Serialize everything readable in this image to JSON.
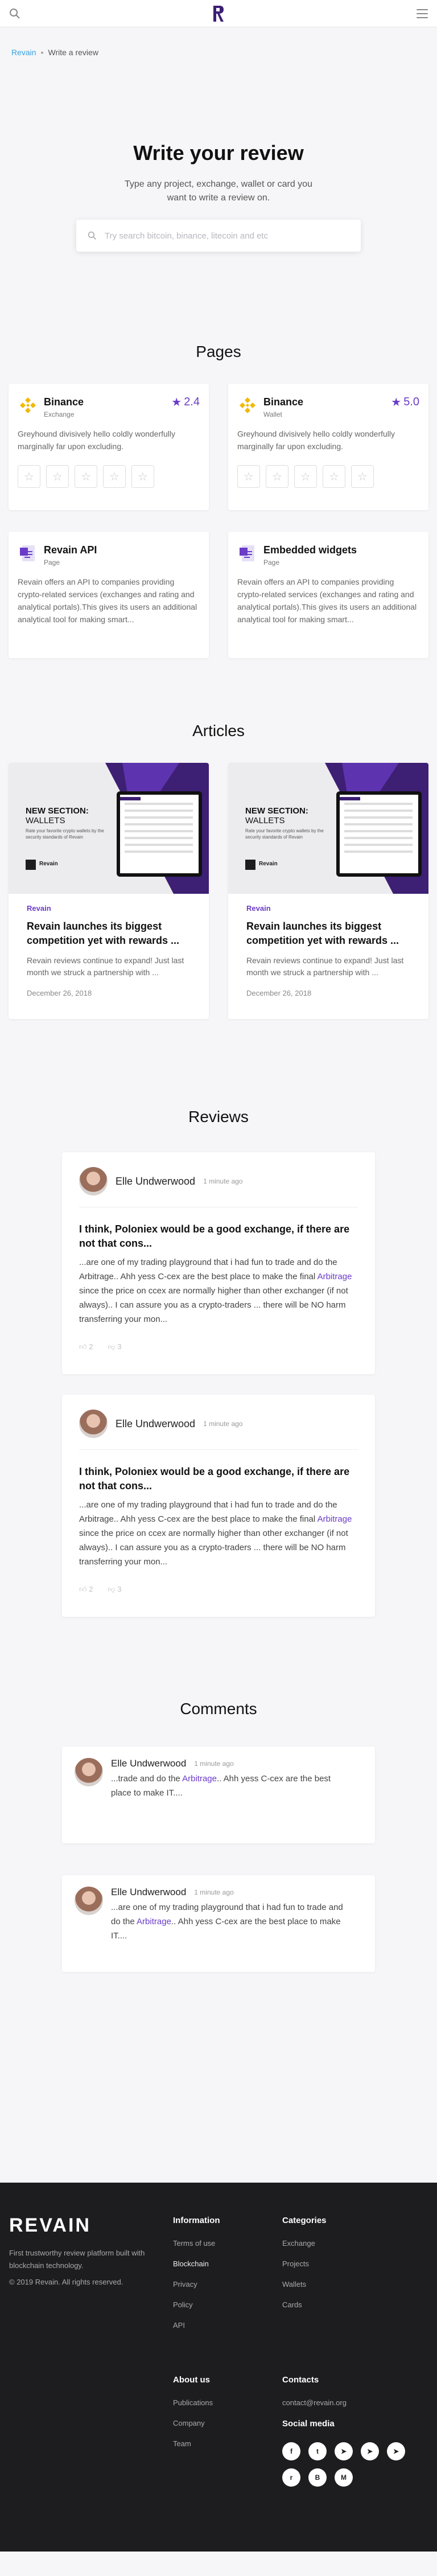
{
  "header": {
    "logo_alt": "Revain"
  },
  "breadcrumb": {
    "home": "Revain",
    "current": "Write a review"
  },
  "hero": {
    "title": "Write your review",
    "subtitle": "Type any project, exchange, wallet or card you want to write a review on.",
    "search_placeholder": "Try search bitcoin, binance, litecoin and etc"
  },
  "pages_section": {
    "title": "Pages",
    "cards": [
      {
        "name": "Binance",
        "type": "Exchange",
        "rating": "2.4",
        "description": "Greyhound divisively hello coldly wonderfully marginally far upon excluding."
      },
      {
        "name": "Binance",
        "type": "Wallet",
        "rating": "5.0",
        "description": "Greyhound divisively hello coldly wonderfully marginally far upon excluding."
      },
      {
        "name": "Revain API",
        "type": "Page",
        "description": "Revain offers an API to companies providing crypto-related services (exchanges and rating and analytical portals).This gives its users an additional analytical tool for making smart..."
      },
      {
        "name": "Embedded widgets",
        "type": "Page",
        "description": "Revain offers an API to companies providing crypto-related services (exchanges and rating and analytical portals).This gives its users an additional analytical tool for making smart..."
      }
    ]
  },
  "articles_section": {
    "title": "Articles",
    "cards": [
      {
        "image_heading": "NEW SECTION:",
        "image_subheading": "WALLETS",
        "image_caption": "Rate your favorite crypto wallets by the security standards of Revain",
        "image_brand": "Revain",
        "label": "Revain",
        "title": "Revain launches its biggest competition yet with rewards ...",
        "text": "Revain reviews continue to expand! Just last month we struck a partnership with ...",
        "date": "December 26, 2018"
      },
      {
        "image_heading": "NEW SECTION:",
        "image_subheading": "WALLETS",
        "image_caption": "Rate your favorite crypto wallets by the security standards of Revain",
        "image_brand": "Revain",
        "label": "Revain",
        "title": "Revain launches its biggest competition yet with rewards ...",
        "text": "Revain reviews continue to expand! Just last month we struck a partnership with ...",
        "date": "December 26, 2018"
      }
    ]
  },
  "reviews_section": {
    "title": "Reviews",
    "items": [
      {
        "user": "Elle Undwerwood",
        "time": "1 minute ago",
        "title": "I think, Poloniex would be a good exchange, if there are not that cons...",
        "text_before": "...are one of my trading playground that i had fun to trade and do the Arbitrage.. Ahh yess C-cex are the best place to make the final ",
        "highlight": "Arbitrage",
        "text_after": " since the price on ccex are normally higher than other exchanger (if not always).. I can assure you as a crypto-traders ... there will be NO harm transferring your mon...",
        "likes": "2",
        "dislikes": "3"
      },
      {
        "user": "Elle Undwerwood",
        "time": "1 minute ago",
        "title": "I think, Poloniex would be a good exchange, if there are not that cons...",
        "text_before": "...are one of my trading playground that i had fun to trade and do the Arbitrage.. Ahh yess C-cex are the best place to make the final ",
        "highlight": "Arbitrage",
        "text_after": " since the price on ccex are normally higher than other exchanger (if not always).. I can assure you as a crypto-traders ... there will be NO harm transferring your mon...",
        "likes": "2",
        "dislikes": "3"
      }
    ]
  },
  "comments_section": {
    "title": "Comments",
    "items": [
      {
        "user": "Elle Undwerwood",
        "time": "1 minute ago",
        "text_before": "...trade and do the ",
        "highlight": "Arbitrage",
        "text_after": ".. Ahh yess C-cex are the best place to make IT...."
      },
      {
        "user": "Elle Undwerwood",
        "time": "1 minute ago",
        "text_before": "...are one of my trading playground that i had fun to trade and do the ",
        "highlight": "Arbitrage",
        "text_after": ".. Ahh yess C-cex are the best place to make IT...."
      }
    ]
  },
  "footer": {
    "logo": "REVAIN",
    "tagline": "First trustworthy review platform built with blockchain technology.",
    "copyright": "© 2019 Revain. All rights reserved.",
    "information": {
      "title": "Information",
      "links": [
        "Terms of use",
        "Blockchain",
        "Privacy",
        "Policy",
        "API"
      ]
    },
    "categories": {
      "title": "Categories",
      "links": [
        "Exchange",
        "Projects",
        "Wallets",
        "Cards"
      ]
    },
    "about": {
      "title": "About us",
      "links": [
        "Publications",
        "Company",
        "Team"
      ]
    },
    "contacts": {
      "title": "Contacts",
      "email": "contact@revain.org",
      "social_title": "Social media"
    },
    "socials": [
      "facebook-icon",
      "twitter-icon",
      "telegram-icon",
      "telegram-icon",
      "telegram-icon",
      "reddit-icon",
      "bitcointalk-icon",
      "medium-icon"
    ],
    "colors": {
      "bg": "#1d1d1f",
      "accent": "#6b3cc9"
    }
  }
}
